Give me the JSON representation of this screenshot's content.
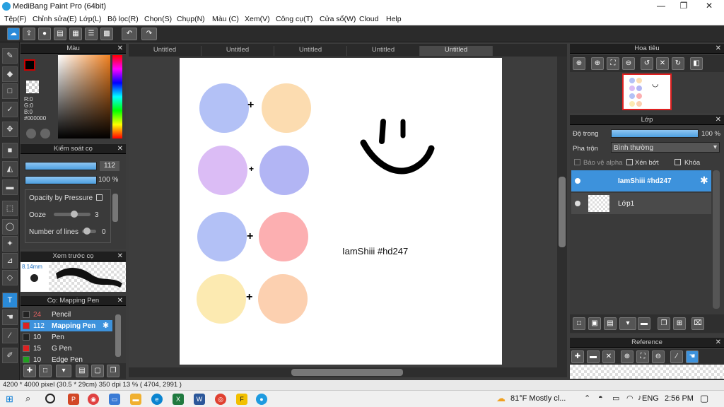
{
  "window": {
    "title": "MediBang Paint Pro (64bit)",
    "minimize": "—",
    "maximize": "❐",
    "close": "✕"
  },
  "menu": [
    "Tệp(F)",
    "Chỉnh sửa(E)",
    "Lớp(L)",
    "Bộ lọc(R)",
    "Chọn(S)",
    "Chụp(N)",
    "Màu (C)",
    "Xem(V)",
    "Công cụ(T)",
    "Cửa sổ(W)",
    "Cloud",
    "Help"
  ],
  "tabs": [
    "Untitled",
    "Untitled",
    "Untitled",
    "Untitled",
    "Untitled"
  ],
  "color_panel": {
    "title": "Màu",
    "r": "R:0",
    "g": "G:0",
    "b": "B:0",
    "hex": "#000000"
  },
  "brush_control": {
    "title": "Kiểm soát cọ",
    "size": "112",
    "opacity": "100 %",
    "opacity_by_pressure": "Opacity by Pressure",
    "ooze_label": "Ooze",
    "ooze_value": "3",
    "lines_label": "Number of lines",
    "lines_value": "0"
  },
  "brush_preview": {
    "title": "Xem trước cọ",
    "size": "8.14mm"
  },
  "brush_list": {
    "title": "Cọ: Mapping Pen",
    "items": [
      {
        "size": "24",
        "name": "Pencil",
        "color": "#222222"
      },
      {
        "size": "112",
        "name": "Mapping Pen",
        "color": "#e02020"
      },
      {
        "size": "10",
        "name": "Pen",
        "color": "#222222"
      },
      {
        "size": "15",
        "name": "G Pen",
        "color": "#e02020"
      },
      {
        "size": "10",
        "name": "Edge Pen",
        "color": "#20a020"
      }
    ]
  },
  "canvas": {
    "text": "IamShiii #hd247",
    "circles": [
      {
        "c1": "#b3c1f6",
        "c2": "#fcdcb0"
      },
      {
        "c1": "#dbbcf5",
        "c2": "#b2b5f4"
      },
      {
        "c1": "#b3c1f6",
        "c2": "#fcafb1"
      },
      {
        "c1": "#fceab1",
        "c2": "#fcd0b0"
      }
    ]
  },
  "navigator": {
    "title": "Hoa tiêu"
  },
  "layers": {
    "title": "Lớp",
    "opacity_label": "Độ trong",
    "opacity_value": "100 %",
    "blend_label": "Pha trộn",
    "blend_value": "Bình thường",
    "protect_alpha": "Bảo vệ alpha",
    "clip": "Xén bớt",
    "lock": "Khóa",
    "items": [
      {
        "name": "IamShiii #hd247"
      },
      {
        "name": "Lớp1"
      }
    ]
  },
  "reference": {
    "title": "Reference"
  },
  "status": {
    "text": "4200 * 4000 pixel  (30.5 * 29cm)  350 dpi  13 %  ( 4704, 2991 )"
  },
  "taskbar": {
    "weather": "81°F  Mostly cl...",
    "lang": "ENG",
    "time": "2:56 PM"
  }
}
